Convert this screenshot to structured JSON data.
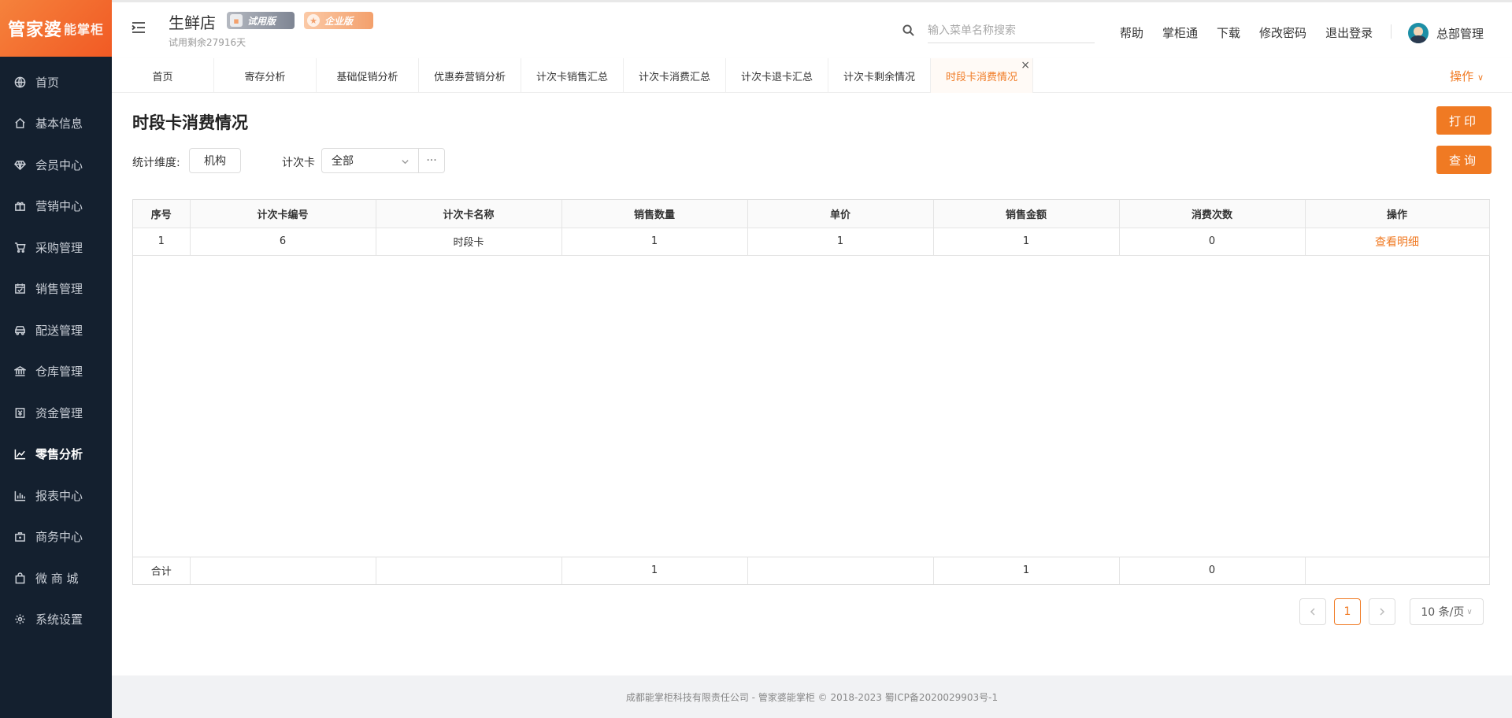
{
  "brand": {
    "logo_main": "管家婆",
    "logo_sub": "能掌柜"
  },
  "sidebar": {
    "items": [
      {
        "label": "首页",
        "icon": "globe-icon"
      },
      {
        "label": "基本信息",
        "icon": "home-icon"
      },
      {
        "label": "会员中心",
        "icon": "diamond-icon"
      },
      {
        "label": "营销中心",
        "icon": "gift-icon"
      },
      {
        "label": "采购管理",
        "icon": "cart-icon"
      },
      {
        "label": "销售管理",
        "icon": "calendar-icon"
      },
      {
        "label": "配送管理",
        "icon": "car-icon"
      },
      {
        "label": "仓库管理",
        "icon": "bank-icon"
      },
      {
        "label": "资金管理",
        "icon": "money-icon"
      },
      {
        "label": "零售分析",
        "icon": "area-chart-icon"
      },
      {
        "label": "报表中心",
        "icon": "bar-chart-icon"
      },
      {
        "label": "商务中心",
        "icon": "briefcase-icon"
      },
      {
        "label": "微 商 城",
        "icon": "bag-icon"
      },
      {
        "label": "系统设置",
        "icon": "gear-icon"
      }
    ],
    "active_index": 9
  },
  "header": {
    "store_name": "生鲜店",
    "badge_trial": "试用版",
    "badge_enterprise": "企业版",
    "trial_left": "试用剩余27916天",
    "search_placeholder": "输入菜单名称搜索",
    "links": [
      "帮助",
      "掌柜通",
      "下载",
      "修改密码",
      "退出登录"
    ],
    "user_name": "总部管理"
  },
  "tabs": {
    "items": [
      "首页",
      "寄存分析",
      "基础促销分析",
      "优惠券营销分析",
      "计次卡销售汇总",
      "计次卡消费汇总",
      "计次卡退卡汇总",
      "计次卡剩余情况",
      "时段卡消费情况"
    ],
    "active_index": 8,
    "close_label": "×",
    "ops_label": "操作"
  },
  "page": {
    "title": "时段卡消费情况",
    "print_label": "打印",
    "query_label": "查询",
    "filters": {
      "dimension_label": "统计维度:",
      "dimension_value": "机构",
      "card_label": "计次卡",
      "card_value": "全部",
      "more_label": "···"
    }
  },
  "table": {
    "headers": [
      "序号",
      "计次卡编号",
      "计次卡名称",
      "销售数量",
      "单价",
      "销售金额",
      "消费次数",
      "操作"
    ],
    "rows": [
      {
        "index": "1",
        "code": "6",
        "name": "时段卡",
        "qty": "1",
        "price": "1",
        "amount": "1",
        "times": "0",
        "action": "查看明细"
      }
    ],
    "totals": {
      "label": "合计",
      "qty": "1",
      "amount": "1",
      "times": "0"
    }
  },
  "pagination": {
    "current": "1",
    "page_size": "10 条/页"
  },
  "footer": {
    "text": "成都能掌柜科技有限责任公司 - 管家婆能掌柜 © 2018-2023 蜀ICP备2020029903号-1"
  },
  "colors": {
    "accent": "#f07a23",
    "sidebar_bg": "#14202f",
    "logo_bg": "#f15a24"
  }
}
